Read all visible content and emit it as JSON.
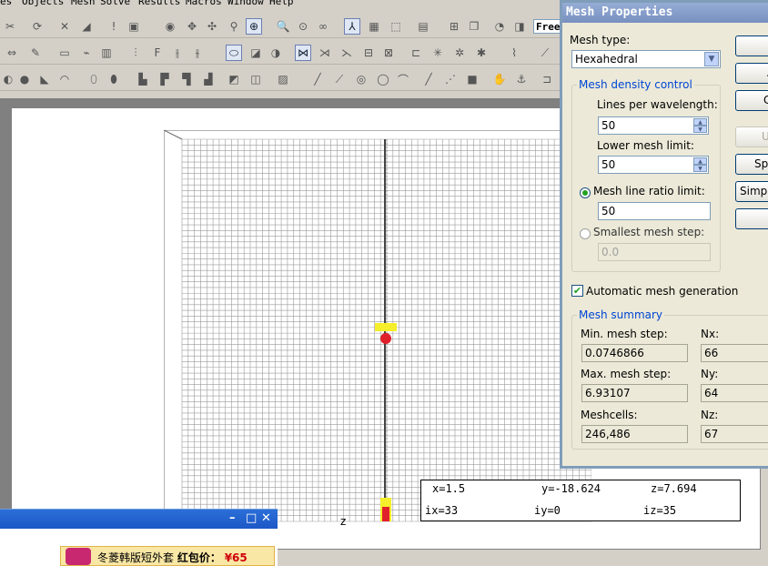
{
  "menu": [
    "es",
    "Objects",
    "Mesh",
    "Solve",
    "Results",
    "Macros",
    "Window",
    "Help"
  ],
  "toolbar": {
    "view_mode_text": "Free"
  },
  "dialog": {
    "title": "Mesh Properties",
    "mesh_type_label": "Mesh type:",
    "mesh_type_value": "Hexahedral",
    "density_group": "Mesh density control",
    "lines_per_wavelength_label": "Lines per wavelength:",
    "lines_per_wavelength_value": "50",
    "lower_mesh_limit_label": "Lower mesh limit:",
    "lower_mesh_limit_value": "50",
    "ratio_limit_label": "Mesh line ratio limit:",
    "ratio_limit_value": "50",
    "smallest_step_label": "Smallest mesh step:",
    "smallest_step_value": "0.0",
    "auto_mesh_label": "Automatic mesh generation",
    "summary_group": "Mesh summary",
    "min_step_label": "Min. mesh step:",
    "min_step_value": "0.0746866",
    "max_step_label": "Max. mesh step:",
    "max_step_value": "6.93107",
    "meshcells_label": "Meshcells:",
    "meshcells_value": "246,486",
    "nx_label": "Nx:",
    "nx_value": "66",
    "ny_label": "Ny:",
    "ny_value": "64",
    "nz_label": "Nz:",
    "nz_value": "67",
    "buttons": [
      "",
      "A",
      "C",
      "Up",
      "Spe",
      "Simplif",
      "I"
    ]
  },
  "status": {
    "x": "x=1.5",
    "y": "y=-18.624",
    "z": "z=7.694",
    "ix": "ix=33",
    "iy": "iy=0",
    "iz": "iz=35"
  },
  "axis_label": "z",
  "popup": {
    "ad_text": "冬菱韩版短外套",
    "price_label": "红包价：",
    "price_value": "¥65"
  }
}
